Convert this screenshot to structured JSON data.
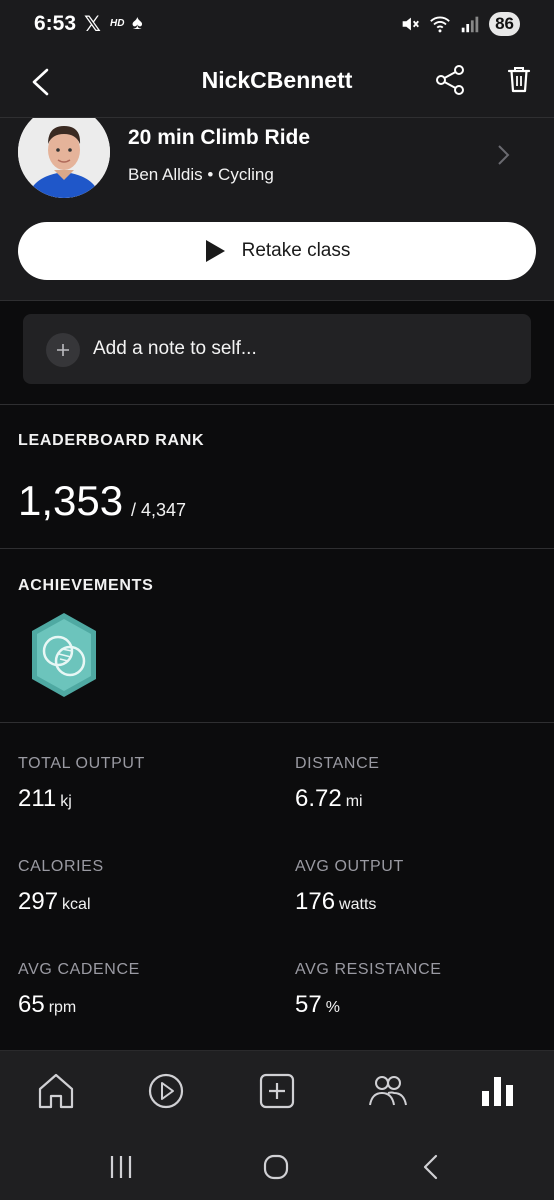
{
  "status_bar": {
    "time": "6:53",
    "x_glyph": "𝕏",
    "hd_label": "HD",
    "spade_glyph": "♠",
    "battery": "86",
    "icons": [
      "x-logo-icon",
      "hd-icon",
      "spade-icon",
      "mute-icon",
      "wifi-icon",
      "signal-icon",
      "battery-icon"
    ]
  },
  "header": {
    "title": "NickCBennett",
    "icons": [
      "back-arrow-icon",
      "share-icon",
      "trash-icon"
    ]
  },
  "class_info": {
    "title": "20 min Climb Ride",
    "subtitle": "Ben Alldis • Cycling",
    "retake_label": "Retake class",
    "icons": [
      "instructor-avatar",
      "chevron-right-icon",
      "play-icon"
    ]
  },
  "note": {
    "placeholder": "Add a note to self...",
    "icon": "plus-icon"
  },
  "leaderboard": {
    "heading": "LEADERBOARD RANK",
    "rank": "1,353",
    "total": "/ 4,347"
  },
  "achievements": {
    "heading": "ACHIEVEMENTS",
    "badge_icon": "achievement-badge-icon",
    "badge_color": "#5bb8b0"
  },
  "metrics": [
    {
      "label": "TOTAL OUTPUT",
      "value": "211",
      "unit": "kj"
    },
    {
      "label": "DISTANCE",
      "value": "6.72",
      "unit": "mi"
    },
    {
      "label": "CALORIES",
      "value": "297",
      "unit": "kcal"
    },
    {
      "label": "AVG OUTPUT",
      "value": "176",
      "unit": "watts"
    },
    {
      "label": "AVG CADENCE",
      "value": "65",
      "unit": "rpm"
    },
    {
      "label": "AVG RESISTANCE",
      "value": "57",
      "unit": "%"
    }
  ],
  "bottom_nav": {
    "items": [
      "home-icon",
      "play-circle-icon",
      "plus-square-icon",
      "community-icon",
      "stats-icon"
    ],
    "active": "stats-icon"
  },
  "system_nav": {
    "items": [
      "recents-icon",
      "home-circle-icon",
      "system-back-icon"
    ]
  }
}
